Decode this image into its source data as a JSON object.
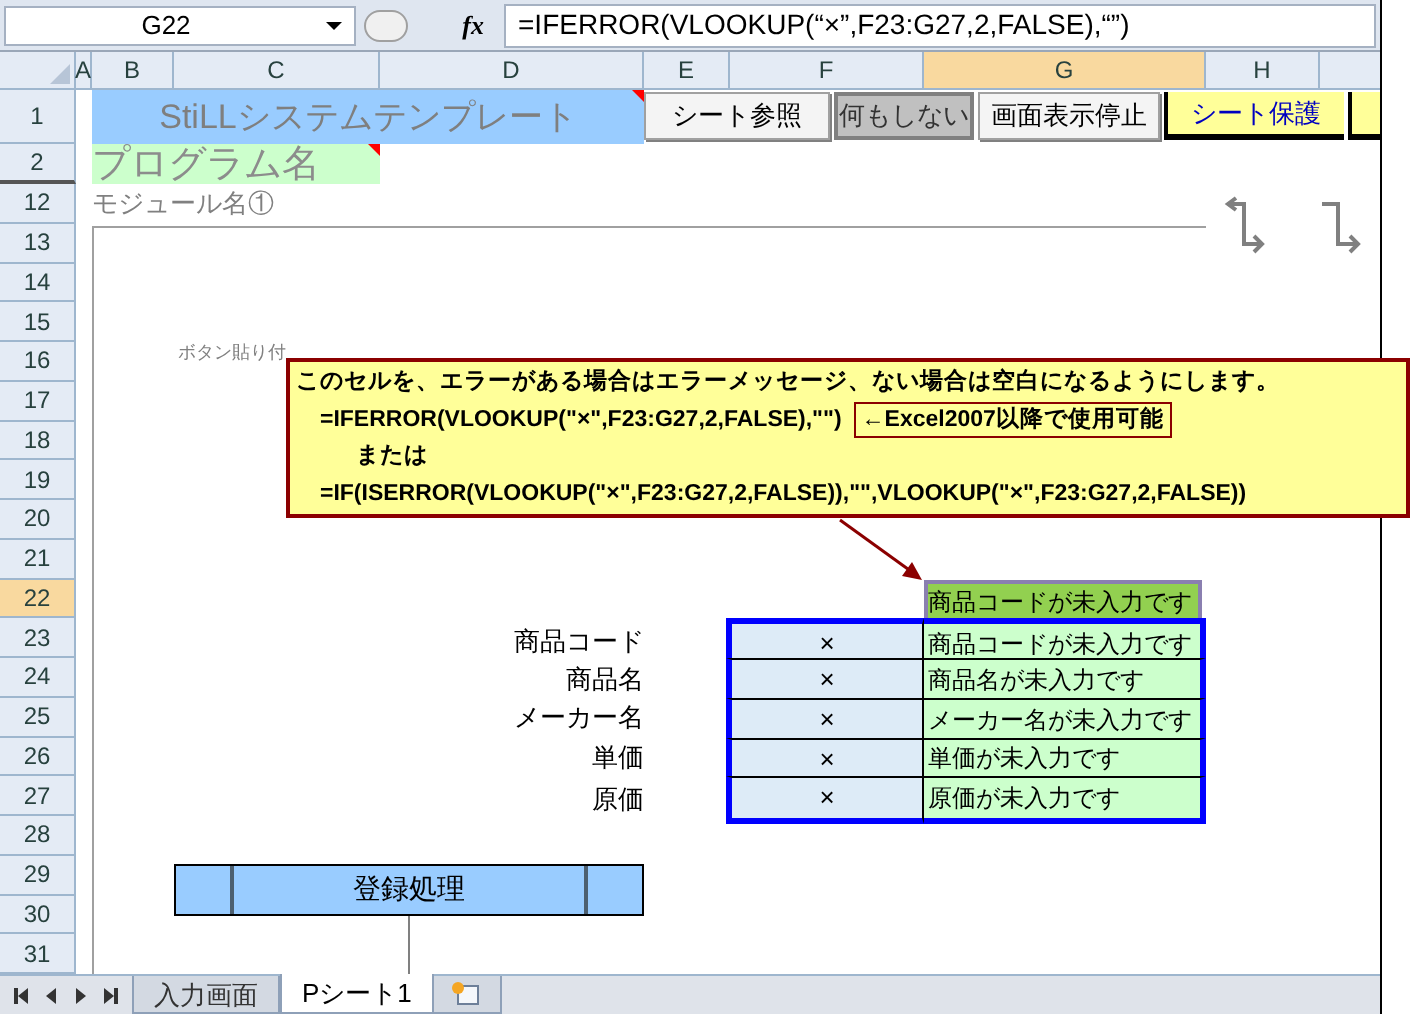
{
  "name_box": "G22",
  "fx_button": "fx",
  "formula": "=IFERROR(VLOOKUP(“×”,F23:G27,2,FALSE),“”)",
  "columns": [
    {
      "label": "A",
      "selected": false
    },
    {
      "label": "B",
      "selected": false
    },
    {
      "label": "C",
      "selected": false
    },
    {
      "label": "D",
      "selected": false
    },
    {
      "label": "E",
      "selected": false
    },
    {
      "label": "F",
      "selected": false
    },
    {
      "label": "G",
      "selected": true
    },
    {
      "label": "H",
      "selected": false
    }
  ],
  "rows": [
    {
      "label": "1",
      "selected": false
    },
    {
      "label": "2",
      "selected": false
    },
    {
      "label": "12",
      "selected": false
    },
    {
      "label": "13",
      "selected": false
    },
    {
      "label": "14",
      "selected": false
    },
    {
      "label": "15",
      "selected": false
    },
    {
      "label": "16",
      "selected": false
    },
    {
      "label": "17",
      "selected": false
    },
    {
      "label": "18",
      "selected": false
    },
    {
      "label": "19",
      "selected": false
    },
    {
      "label": "20",
      "selected": false
    },
    {
      "label": "21",
      "selected": false
    },
    {
      "label": "22",
      "selected": true
    },
    {
      "label": "23",
      "selected": false
    },
    {
      "label": "24",
      "selected": false
    },
    {
      "label": "25",
      "selected": false
    },
    {
      "label": "26",
      "selected": false
    },
    {
      "label": "27",
      "selected": false
    },
    {
      "label": "28",
      "selected": false
    },
    {
      "label": "29",
      "selected": false
    },
    {
      "label": "30",
      "selected": false
    },
    {
      "label": "31",
      "selected": false
    }
  ],
  "title": "StiLLシステムテンプレート",
  "program_name": "プログラム名",
  "module_name": "モジュール名①",
  "placeholder_label": "ボタン貼り付",
  "buttons": [
    {
      "label": "シート参照",
      "kind": "normal"
    },
    {
      "label": "何もしない",
      "kind": "pressed"
    },
    {
      "label": "画面表示停止",
      "kind": "normal"
    },
    {
      "label": "シート保護",
      "kind": "toggle"
    },
    {
      "kind": "toggle"
    }
  ],
  "comment": {
    "lines": [
      {
        "kind": "sentence",
        "text": "このセルを、エラーがある場合はエラーメッセージ、ない場合は空白になるようにします。"
      },
      {
        "kind": "formula",
        "text": "=IFERROR(VLOOKUP(\"×\",F23:G27,2,FALSE),\"\")",
        "note": "←Excel2007以降で使用可能"
      },
      {
        "kind": "connector",
        "text": "または"
      },
      {
        "kind": "formula",
        "text": "=IF(ISERROR(VLOOKUP(\"×\",F23:G27,2,FALSE)),\"\",VLOOKUP(\"×\",F23:G27,2,FALSE))"
      }
    ]
  },
  "result_cell": "商品コードが未入力です",
  "fields": [
    {
      "label": "商品コード",
      "mark": "×",
      "message": "商品コードが未入力です"
    },
    {
      "label": "商品名",
      "mark": "×",
      "message": "商品名が未入力です"
    },
    {
      "label": "メーカー名",
      "mark": "×",
      "message": "メーカー名が未入力です"
    },
    {
      "label": "単価",
      "mark": "×",
      "message": "単価が未入力です"
    },
    {
      "label": "原価",
      "mark": "×",
      "message": "原価が未入力です"
    }
  ],
  "register_button": "登録処理",
  "sheet_tabs": [
    {
      "label": "入力画面",
      "selected": false
    },
    {
      "label": "Pシート1",
      "selected": true
    }
  ]
}
